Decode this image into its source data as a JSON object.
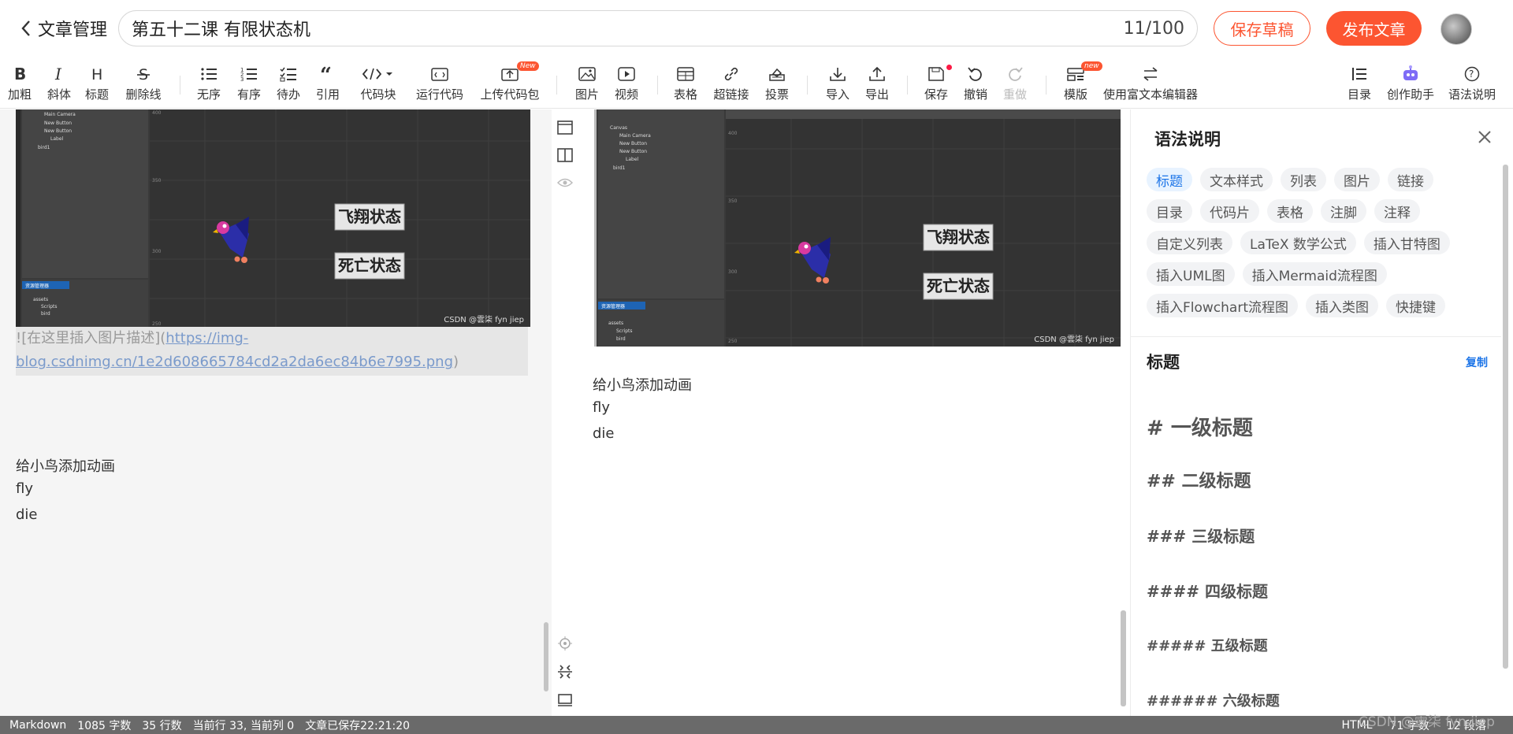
{
  "header": {
    "back_label": "文章管理",
    "title_value": "第五十二课 有限状态机",
    "title_count": "11/100",
    "save_draft": "保存草稿",
    "publish": "发布文章"
  },
  "toolbar": {
    "bold": "加粗",
    "italic": "斜体",
    "heading": "标题",
    "strike": "删除线",
    "ul": "无序",
    "ol": "有序",
    "todo": "待办",
    "quote": "引用",
    "codeblock": "代码块",
    "runcode": "运行代码",
    "upload_code": "上传代码包",
    "new_badge": "New",
    "image": "图片",
    "video": "视频",
    "table": "表格",
    "link": "超链接",
    "vote": "投票",
    "import": "导入",
    "export": "导出",
    "save": "保存",
    "undo": "撤销",
    "redo": "重做",
    "template": "模版",
    "template_badge": "new",
    "rich_editor": "使用富文本编辑器",
    "toc": "目录",
    "assistant": "创作助手",
    "syntax_help": "语法说明"
  },
  "editor": {
    "md_prefix": "![在这里插入图片描述](",
    "md_url_1": "https://img-",
    "md_url_2": "blog.csdnimg.cn/1e2d608665784cd2a2da6ec84b6e7995.png",
    "md_suffix": ")",
    "lines": [
      "给小鸟添加动画",
      "fly",
      "die"
    ]
  },
  "scene": {
    "hierarchy": [
      "Canvas",
      "Main Camera",
      "New Button",
      "New Button",
      "Label",
      "bird1"
    ],
    "assets_tab": "资源管理器",
    "assets": [
      "assets",
      "Scripts",
      "bird"
    ],
    "btn_fly": "飞翔状态",
    "btn_die": "死亡状态",
    "axis": [
      "400",
      "350",
      "300",
      "250"
    ],
    "credit": "CSDN @雲柒 fyn jiep"
  },
  "preview": {
    "lines": [
      "给小鸟添加动画",
      "fly",
      "die"
    ]
  },
  "panel": {
    "title": "语法说明",
    "tags": [
      "标题",
      "文本样式",
      "列表",
      "图片",
      "链接",
      "目录",
      "代码片",
      "表格",
      "注脚",
      "注释",
      "自定义列表",
      "LaTeX 数学公式",
      "插入甘特图",
      "插入UML图",
      "插入Mermaid流程图",
      "插入Flowchart流程图",
      "插入类图",
      "快捷键"
    ],
    "section_title": "标题",
    "copy": "复制",
    "headings": [
      "# 一级标题",
      "## 二级标题",
      "### 三级标题",
      "#### 四级标题",
      "##### 五级标题",
      "###### 六级标题"
    ]
  },
  "status": {
    "mode": "Markdown",
    "chars": "1085 字数",
    "lines": "35 行数",
    "cursor": "当前行 33, 当前列 0",
    "saved": "文章已保存22:21:20",
    "right_mode": "HTML",
    "right_chars": "71 字数",
    "right_paras": "12 段落",
    "watermark": "CSDN @雲柒 fyn jiep"
  },
  "colors": {
    "accent": "#fc5531",
    "link": "#1d75e8",
    "status_bg": "#6a6a6a"
  }
}
